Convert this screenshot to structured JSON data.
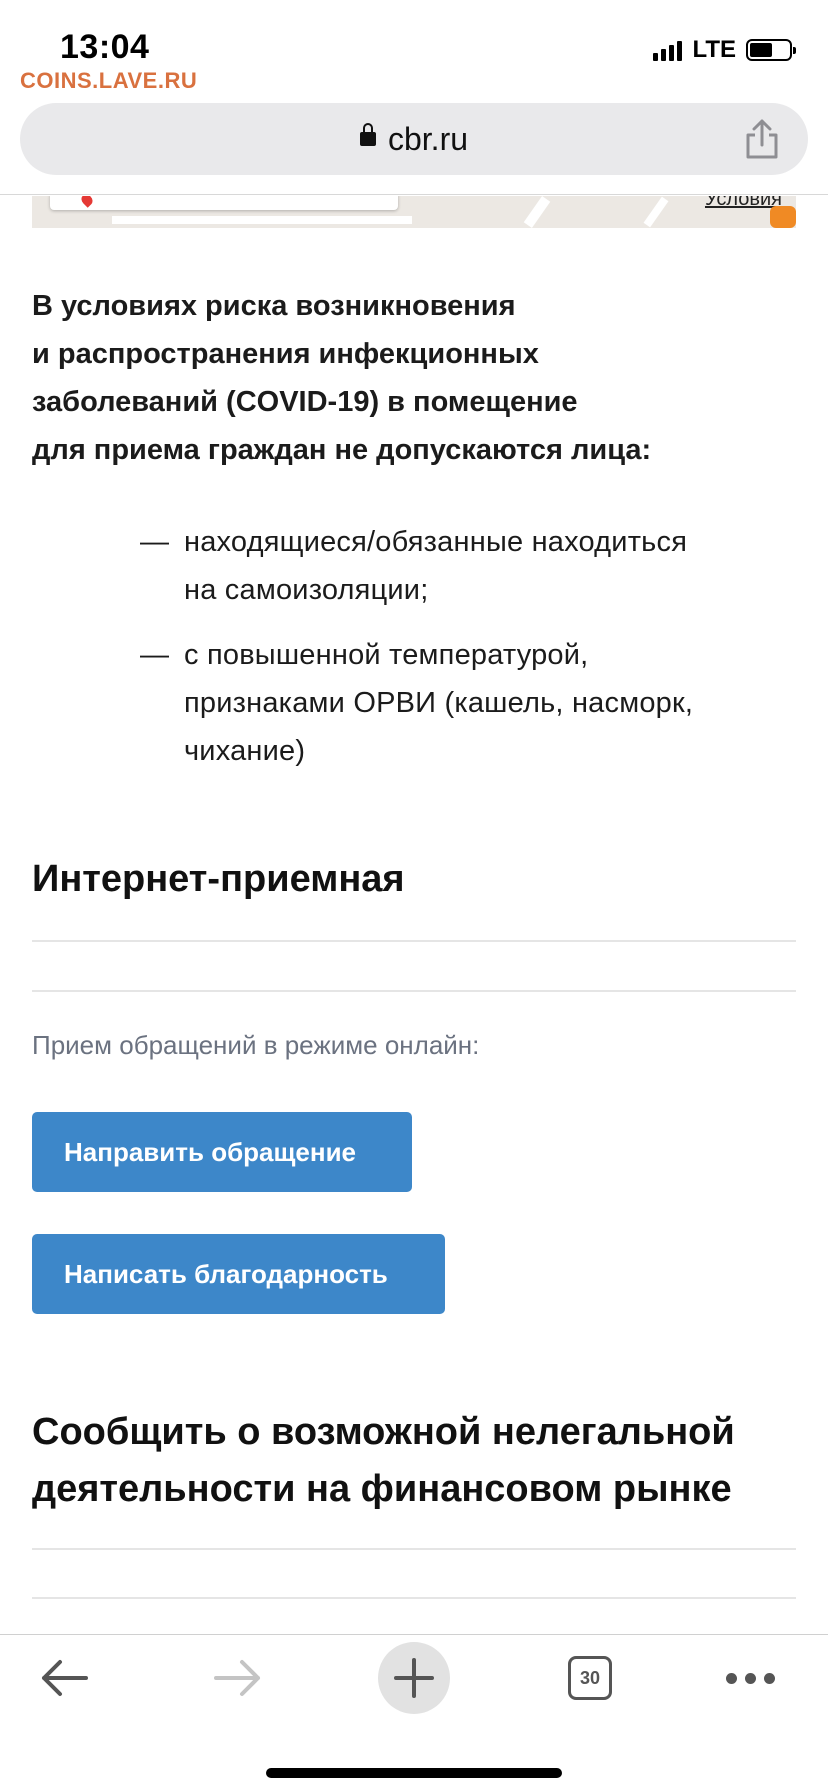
{
  "status_bar": {
    "time": "13:04",
    "watermark": "COINS.LAVE.RU",
    "network": "LTE"
  },
  "browser": {
    "url": "cbr.ru",
    "tab_count": "30"
  },
  "map": {
    "link_label": "Условия"
  },
  "notice": {
    "lines": [
      "В условиях риска возникновения",
      "и распространения инфекционных",
      "заболеваний (COVID-19) в помещение",
      "для приема граждан не допускаются лица:"
    ]
  },
  "restrictions": [
    {
      "dash": "—",
      "lines": [
        "находящиеся/обязанные находиться",
        "на самоизоляции;"
      ]
    },
    {
      "dash": "—",
      "lines": [
        "с повышенной температурой,",
        "признаками ОРВИ (кашель, насморк,",
        "чихание)"
      ]
    }
  ],
  "internet_reception": {
    "heading": "Интернет-приемная",
    "online_label": "Прием обращений в режиме онлайн:",
    "buttons": {
      "send_request": "Направить обращение",
      "send_thanks": "Написать благодарность"
    }
  },
  "report_section": {
    "heading_lines": [
      "Сообщить о возможной нелегальной",
      "деятельности на финансовом рынке"
    ]
  },
  "colors": {
    "button": "#3d87c9",
    "watermark": "#d9713f",
    "url_bar": "#e9e9eb"
  }
}
